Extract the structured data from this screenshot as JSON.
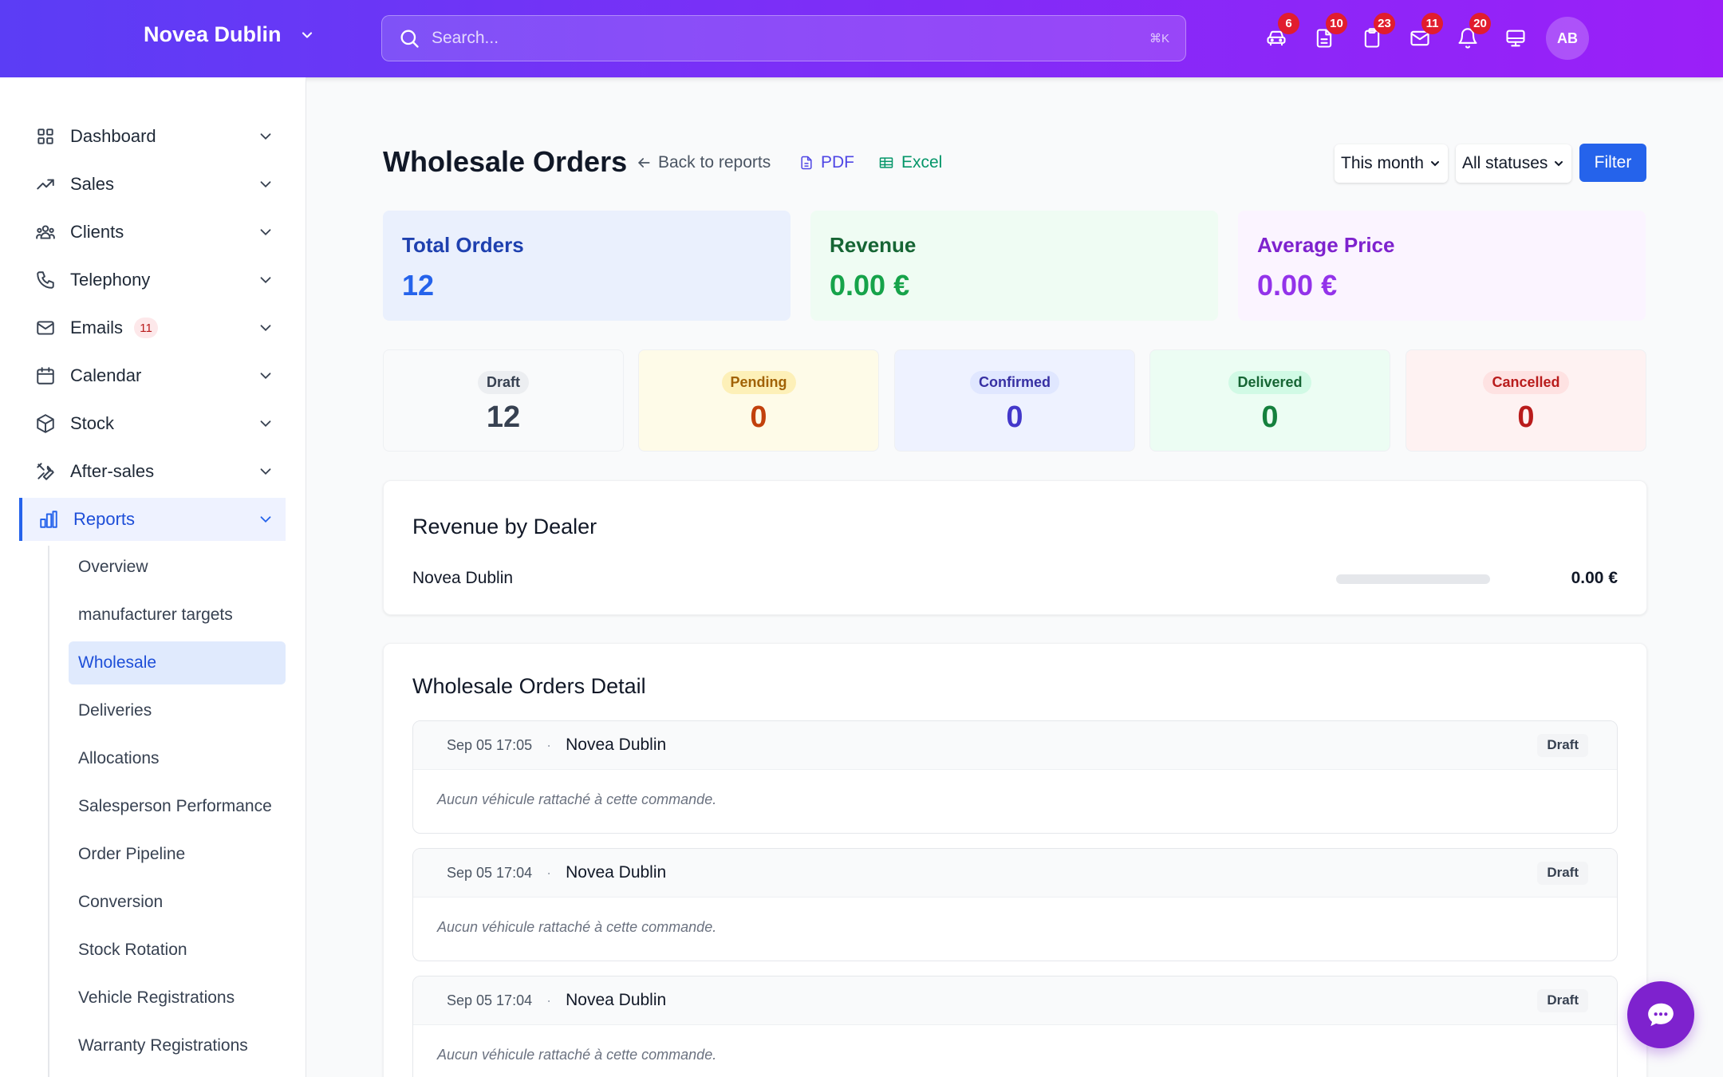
{
  "header": {
    "dealer_name": "Novea Dublin",
    "search_placeholder": "Search...",
    "search_shortcut": "⌘K",
    "icons": [
      {
        "icon": "car-icon",
        "badge": "6"
      },
      {
        "icon": "document-icon",
        "badge": "10"
      },
      {
        "icon": "clipboard-icon",
        "badge": "23"
      },
      {
        "icon": "mail-icon",
        "badge": "11"
      },
      {
        "icon": "bell-icon",
        "badge": "20"
      },
      {
        "icon": "monitor-icon",
        "badge": ""
      }
    ],
    "avatar_initials": "AB"
  },
  "sidebar": {
    "items": [
      {
        "label": "Dashboard",
        "icon": "grid-icon"
      },
      {
        "label": "Sales",
        "icon": "trending-up-icon"
      },
      {
        "label": "Clients",
        "icon": "users-icon"
      },
      {
        "label": "Telephony",
        "icon": "phone-icon"
      },
      {
        "label": "Emails",
        "icon": "mail-icon",
        "badge": "11"
      },
      {
        "label": "Calendar",
        "icon": "calendar-icon"
      },
      {
        "label": "Stock",
        "icon": "box-icon"
      },
      {
        "label": "After-sales",
        "icon": "tools-icon"
      },
      {
        "label": "Reports",
        "icon": "bar-chart-icon",
        "active": true
      }
    ],
    "report_subitems": [
      "Overview",
      "manufacturer targets",
      "Wholesale",
      "Deliveries",
      "Allocations",
      "Salesperson Performance",
      "Order Pipeline",
      "Conversion",
      "Stock Rotation",
      "Vehicle Registrations",
      "Warranty Registrations"
    ],
    "active_subitem": "Wholesale"
  },
  "page": {
    "title": "Wholesale Orders",
    "back_label": "Back to reports",
    "pdf_label": "PDF",
    "excel_label": "Excel",
    "period_select": "This month",
    "status_select": "All statuses",
    "filter_label": "Filter"
  },
  "stats": {
    "total_orders": {
      "label": "Total Orders",
      "value": "12"
    },
    "revenue": {
      "label": "Revenue",
      "value": "0.00 €"
    },
    "average_price": {
      "label": "Average Price",
      "value": "0.00 €"
    }
  },
  "status_counts": [
    {
      "label": "Draft",
      "value": "12"
    },
    {
      "label": "Pending",
      "value": "0"
    },
    {
      "label": "Confirmed",
      "value": "0"
    },
    {
      "label": "Delivered",
      "value": "0"
    },
    {
      "label": "Cancelled",
      "value": "0"
    }
  ],
  "revenue_by_dealer": {
    "title": "Revenue by Dealer",
    "rows": [
      {
        "dealer": "Novea Dublin",
        "amount": "0.00 €",
        "share": 0
      }
    ]
  },
  "orders_detail": {
    "title": "Wholesale Orders Detail",
    "orders": [
      {
        "date": "Sep 05 17:05",
        "dealer": "Novea Dublin",
        "status": "Draft",
        "note": "Aucun véhicule rattaché à cette commande."
      },
      {
        "date": "Sep 05 17:04",
        "dealer": "Novea Dublin",
        "status": "Draft",
        "note": "Aucun véhicule rattaché à cette commande."
      },
      {
        "date": "Sep 05 17:04",
        "dealer": "Novea Dublin",
        "status": "Draft",
        "note": "Aucun véhicule rattaché à cette commande."
      }
    ]
  },
  "colors": {
    "accent": "#2563eb",
    "header_gradient_start": "#5b3df5",
    "header_gradient_end": "#9b1ff8",
    "badge_red": "#e11d2e"
  }
}
